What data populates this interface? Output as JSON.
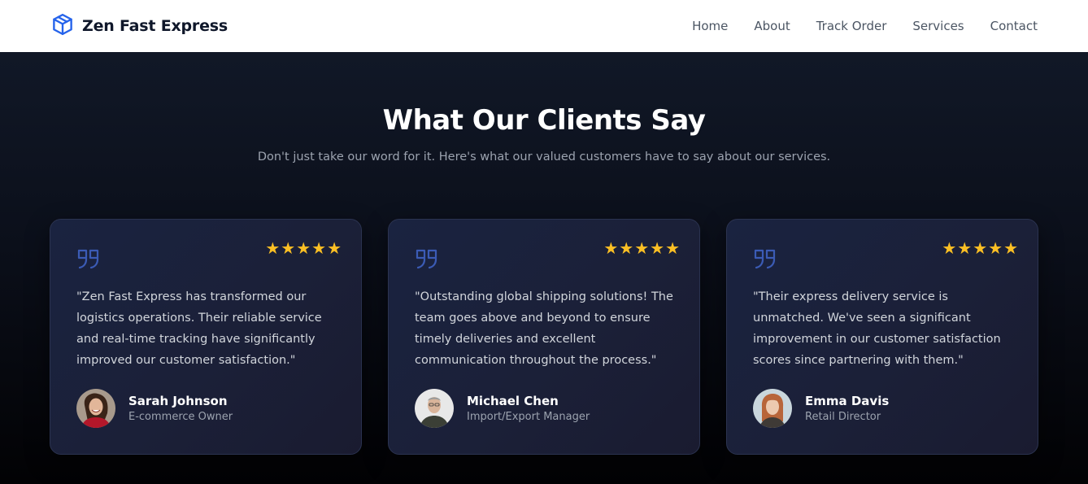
{
  "nav": {
    "brand": "Zen Fast Express",
    "brand_icon": "package-box-icon",
    "links": [
      "Home",
      "About",
      "Track Order",
      "Services",
      "Contact"
    ]
  },
  "testimonials": {
    "title": "What Our Clients Say",
    "subtitle": "Don't just take our word for it. Here's what our valued customers have to say about our services.",
    "cards": [
      {
        "rating": 5,
        "text": "\"Zen Fast Express has transformed our logistics operations. Their reliable service and real-time tracking have significantly improved our customer satisfaction.\"",
        "name": "Sarah Johnson",
        "role": "E-commerce Owner"
      },
      {
        "rating": 5,
        "text": "\"Outstanding global shipping solutions! The team goes above and beyond to ensure timely deliveries and excellent communication throughout the process.\"",
        "name": "Michael Chen",
        "role": "Import/Export Manager"
      },
      {
        "rating": 5,
        "text": "\"Their express delivery service is unmatched. We've seen a significant improvement in our customer satisfaction scores since partnering with them.\"",
        "name": "Emma Davis",
        "role": "Retail Director"
      }
    ]
  },
  "colors": {
    "accent_blue": "#2563eb",
    "star_yellow": "#fbbf24",
    "quote_icon": "#3b5bb5"
  }
}
